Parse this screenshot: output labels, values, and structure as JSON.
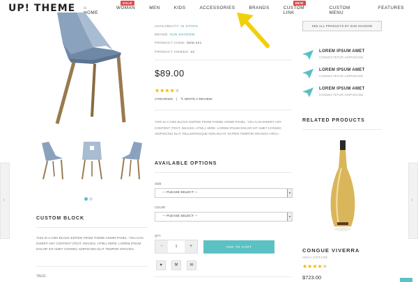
{
  "brand": {
    "logo_text": "UP! THEME"
  },
  "nav": {
    "items": [
      {
        "label": "HOME",
        "icon": "home-icon"
      },
      {
        "label": "WOMAN",
        "badge": "SALE"
      },
      {
        "label": "MEN"
      },
      {
        "label": "KIDS"
      },
      {
        "label": "ACCESSORIES"
      },
      {
        "label": "BRANDS"
      },
      {
        "label": "CUSTOM LINK",
        "badge": "NEW"
      },
      {
        "label": "CUSTOM MENU"
      },
      {
        "label": "FEATURES"
      }
    ]
  },
  "product": {
    "availability_label": "AVAILABILITY:",
    "availability_value": "IN STOCK",
    "brand_label": "BRAND:",
    "brand_value": "SUN SHADOW",
    "code_label": "PRODUCT CODE:",
    "code_value": "SEM.321",
    "viewed_label": "PRODUCT VIEWED:",
    "viewed_value": "22",
    "price": "$89.00",
    "rating": 4,
    "rating_max": 5,
    "reviews_count": "3 REVIEWS",
    "write_review": "WRITE A REVIEW",
    "cms_text": "THIS IS A CMS BLOCK EDITED FROM THEME ADMIN PANEL. YOU CAN INSERT ANY CONTENT (TEXT, IMAGES, HTML) HERE. LOREM IPSUM DOLOR SIT AMET CONSEC ADIPISCING ELIT. PELLENTESQUE NON DUI AT SAPIEN TEMPOR GRAVIDA ARCU.",
    "options_title": "AVAILABLE OPTIONS",
    "size_label": "SIZE",
    "size_value": "--- PLEASE SELECT ---",
    "color_label": "COLOR",
    "color_value": "--- PLEASE SELECT ---",
    "qty_label": "QTY",
    "qty_minus": "-",
    "qty_value": "1",
    "qty_plus": "+",
    "add_to_cart": "ADD TO CART",
    "gallery_slide": 1,
    "gallery_slides": 2
  },
  "left": {
    "custom_block_title": "CUSTOM BLOCK",
    "custom_block_text": "THIS IS A CMS BLOCK EDITED FROM THEME ADMIN PANEL. YOU CAN INSERT ANY CONTENT (TEXT, IMAGES, HTML) HERE. LOREM IPSUM DOLOR SIT AMET CONSEC ADIPISCING ELIT TEMPOR GRAVIDA.",
    "tags_label": "TAGS:"
  },
  "right": {
    "see_all": "SEE ALL PRODUCTS BY SUN SHADOW",
    "features": [
      {
        "title": "LOREM IPSUM AMET",
        "subtitle": "CONSECTETUR ADIPISCING"
      },
      {
        "title": "LOREM IPSUM AMET",
        "subtitle": "CONSECTETUR ADIPISCING"
      },
      {
        "title": "LOREM IPSUM AMET",
        "subtitle": "CONSECTETUR ADIPISCING"
      }
    ],
    "related_title": "RELATED PRODUCTS",
    "related_product": {
      "name": "CONGUE VIVERRA",
      "subtitle": "ANCA VINTAGE",
      "rating": 4,
      "rating_max": 5,
      "price": "$723.00"
    }
  },
  "colors": {
    "accent": "#5cc1c3",
    "link": "#4a9fb5",
    "star": "#f3b400",
    "sale_badge": "#e04a4a",
    "annotation_arrow": "#f2cf0b"
  }
}
